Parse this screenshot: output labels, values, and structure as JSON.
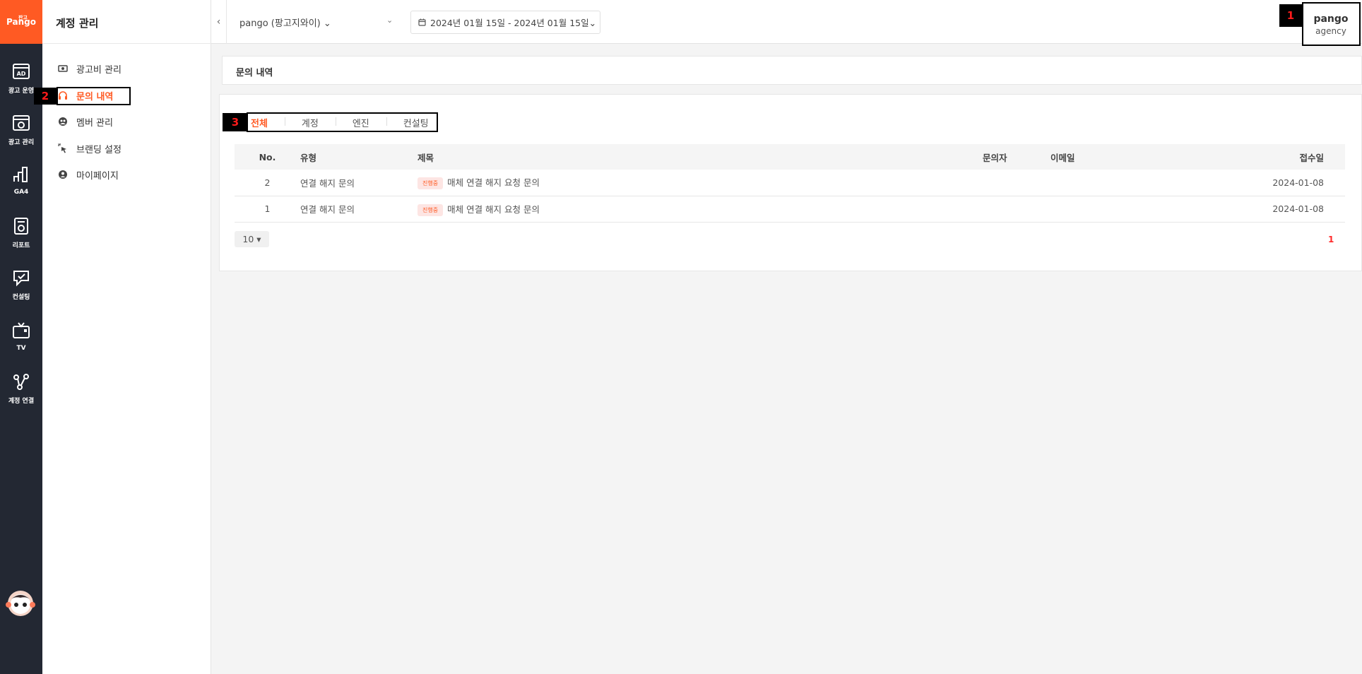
{
  "brand": {
    "logo_text": "Pango",
    "logo_small": "판고"
  },
  "rail": {
    "items": [
      {
        "label": "광고 운영",
        "icon": "ad-icon"
      },
      {
        "label": "광고 관리",
        "icon": "gear-box-icon"
      },
      {
        "label": "GA4",
        "icon": "bar-chart-icon"
      },
      {
        "label": "리포트",
        "icon": "report-icon"
      },
      {
        "label": "컨설팅",
        "icon": "consulting-icon"
      },
      {
        "label": "TV",
        "icon": "tv-icon"
      },
      {
        "label": "계정 연결",
        "icon": "connect-icon"
      }
    ]
  },
  "sidebar": {
    "title": "계정 관리",
    "items": [
      {
        "label": "광고비 관리",
        "icon": "money-icon"
      },
      {
        "label": "문의 내역",
        "icon": "headset-icon",
        "active": true
      },
      {
        "label": "멤버 관리",
        "icon": "members-icon"
      },
      {
        "label": "브랜딩 설정",
        "icon": "pointer-sparkle-icon"
      },
      {
        "label": "마이페이지",
        "icon": "user-circle-icon"
      }
    ]
  },
  "topbar": {
    "account": "pango (팡고지와이) ⌄",
    "date_range": "2024년 01월 15일 - 2024년 01월 15일⌄",
    "user_name": "pango",
    "user_role": "agency"
  },
  "page": {
    "breadcrumb": "문의 내역"
  },
  "tabs": [
    "전체",
    "계정",
    "엔진",
    "컨설팅"
  ],
  "table": {
    "headers": {
      "no": "No.",
      "type": "유형",
      "title": "제목",
      "inquirer": "문의자",
      "email": "이메일",
      "date": "접수일"
    },
    "rows": [
      {
        "no": "2",
        "type": "연결 해지 문의",
        "badge": "진행중",
        "title": "매체 연결 해지 요청 문의",
        "inquirer": "",
        "email": "",
        "date": "2024-01-08"
      },
      {
        "no": "1",
        "type": "연결 해지 문의",
        "badge": "진행중",
        "title": "매체 연결 해지 요청 문의",
        "inquirer": "",
        "email": "",
        "date": "2024-01-08"
      }
    ]
  },
  "pagination": {
    "page_size": "10 ▾",
    "current_page": "1"
  },
  "markers": [
    "1",
    "2",
    "3"
  ],
  "colors": {
    "accent": "#ff5a23",
    "rail": "#232833",
    "marker_text": "#ff1b1b"
  }
}
